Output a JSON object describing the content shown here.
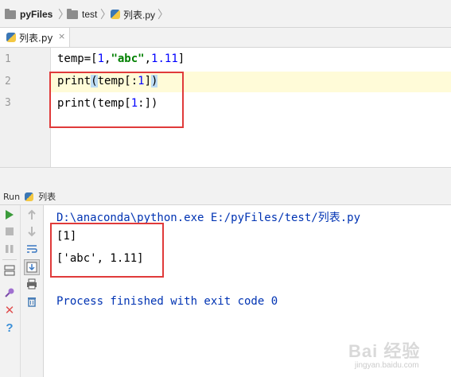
{
  "breadcrumb": {
    "items": [
      {
        "label": "pyFiles",
        "icon": "folder-icon"
      },
      {
        "label": "test",
        "icon": "folder-icon"
      },
      {
        "label": "列表.py",
        "icon": "python-file-icon"
      }
    ]
  },
  "editor_tab": {
    "label": "列表.py",
    "close_symbol": "×"
  },
  "editor": {
    "line_numbers": [
      "1",
      "2",
      "3"
    ],
    "lines": [
      {
        "parts": [
          "temp=[",
          "1",
          ",",
          "\"abc\"",
          ",",
          "1.11",
          "]"
        ]
      },
      {
        "parts": [
          "print",
          "(",
          "temp[:",
          "1",
          "]",
          ")"
        ]
      },
      {
        "parts": [
          "print(temp[",
          "1",
          ":])"
        ]
      }
    ]
  },
  "run_panel": {
    "label": "Run",
    "config_name": "列表",
    "output": [
      "D:\\anaconda\\python.exe E:/pyFiles/test/列表.py",
      "[1]",
      "['abc', 1.11]",
      "",
      "Process finished with exit code 0"
    ]
  },
  "watermark": {
    "text": "Bai 经验",
    "sub": "jingyan.baidu.com"
  },
  "colors": {
    "highlight_box": "#e03a3a",
    "console_text": "#0033b3",
    "current_line": "#fffbd8",
    "brace_match": "#bcdcf4"
  },
  "toolbar_icons": [
    "run-icon",
    "stop-icon",
    "pause-icon",
    "layout-icon",
    "pin-icon",
    "close-icon",
    "help-icon",
    "up-arrow-icon",
    "down-arrow-icon",
    "soft-wrap-icon",
    "scroll-to-end-icon",
    "print-icon",
    "trash-icon"
  ]
}
